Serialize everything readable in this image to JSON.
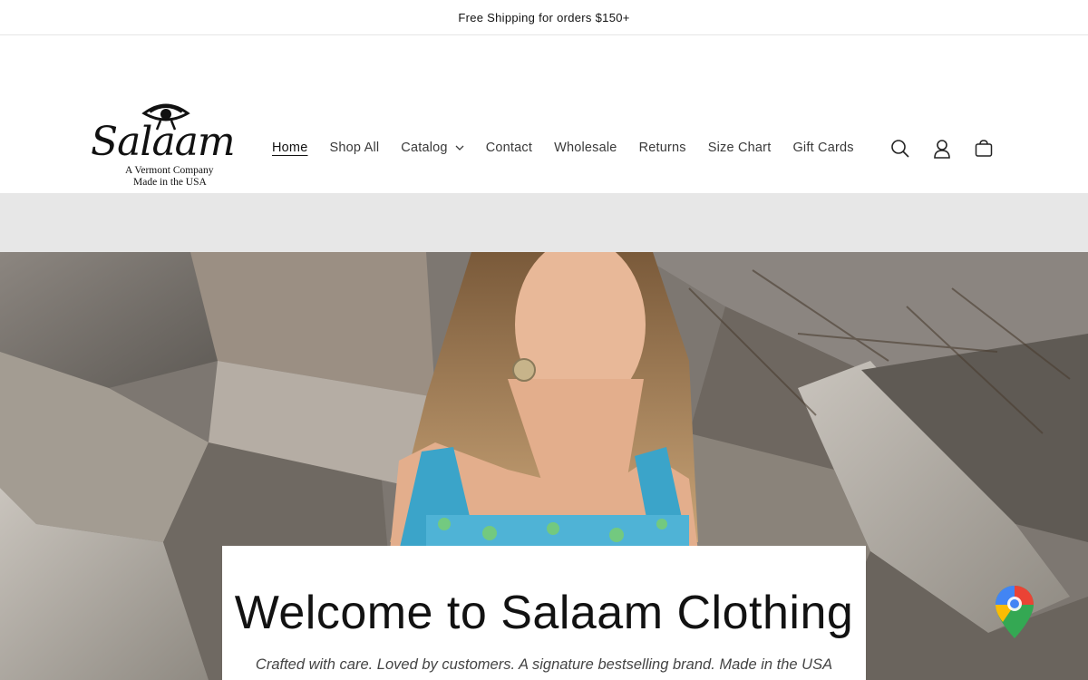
{
  "announcement": {
    "text": "Free Shipping for orders $150+"
  },
  "logo": {
    "brand": "Salaam",
    "tagline_1": "A Vermont Company",
    "tagline_2": "Made in the USA"
  },
  "nav": {
    "items": [
      {
        "label": "Home",
        "active": true
      },
      {
        "label": "Shop All"
      },
      {
        "label": "Catalog",
        "has_dropdown": true
      },
      {
        "label": "Contact"
      },
      {
        "label": "Wholesale"
      },
      {
        "label": "Returns"
      },
      {
        "label": "Size Chart"
      },
      {
        "label": "Gift Cards"
      }
    ]
  },
  "header_icons": [
    "search-icon",
    "account-icon",
    "cart-icon"
  ],
  "hero": {
    "title": "Welcome to Salaam Clothing",
    "subtitle": "Crafted with care. Loved by customers. A signature bestselling brand. Made in the USA"
  },
  "colors": {
    "band": "#e7e7e7",
    "text": "#121212",
    "muted": "#3a3a3a"
  }
}
